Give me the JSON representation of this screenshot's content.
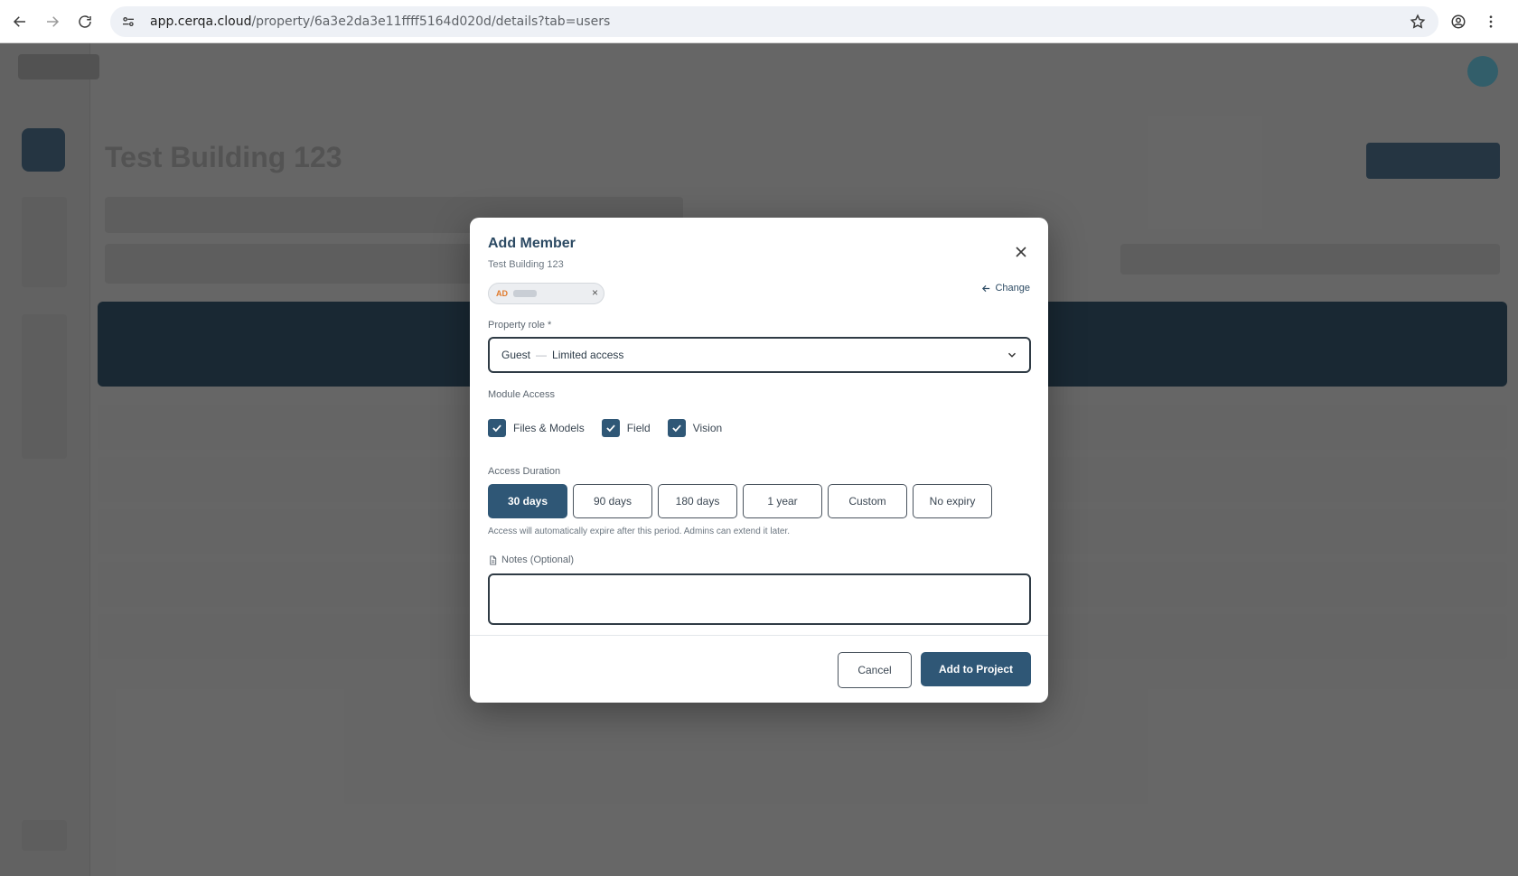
{
  "browser": {
    "url_host": "app.cerqa.cloud",
    "url_path": "/property/6a3e2da3e11ffff5164d020d/details?tab=users"
  },
  "background": {
    "page_title": "Test Building 123"
  },
  "modal": {
    "title": "Add Member",
    "subtitle": "Test Building 123",
    "selected_user": {
      "initials": "AD",
      "remove_glyph": "×"
    },
    "change_label": "Change",
    "property_role": {
      "label": "Property role *",
      "value_role": "Guest",
      "value_separator": "—",
      "value_desc": "Limited access"
    },
    "module_access": {
      "label": "Module Access",
      "items": [
        {
          "label": "Files & Models",
          "checked": true
        },
        {
          "label": "Field",
          "checked": true
        },
        {
          "label": "Vision",
          "checked": true
        }
      ]
    },
    "access_duration": {
      "label": "Access Duration",
      "options": [
        "30 days",
        "90 days",
        "180 days",
        "1 year",
        "Custom",
        "No expiry"
      ],
      "selected": "30 days",
      "hint": "Access will automatically expire after this period. Admins can extend it later."
    },
    "notes": {
      "label": "Notes (Optional)",
      "value": ""
    },
    "cancel_label": "Cancel",
    "submit_label": "Add to Project"
  },
  "colors": {
    "primary": "#2f5776",
    "title": "#2c4a63",
    "overlay": "#6e6e6e"
  }
}
